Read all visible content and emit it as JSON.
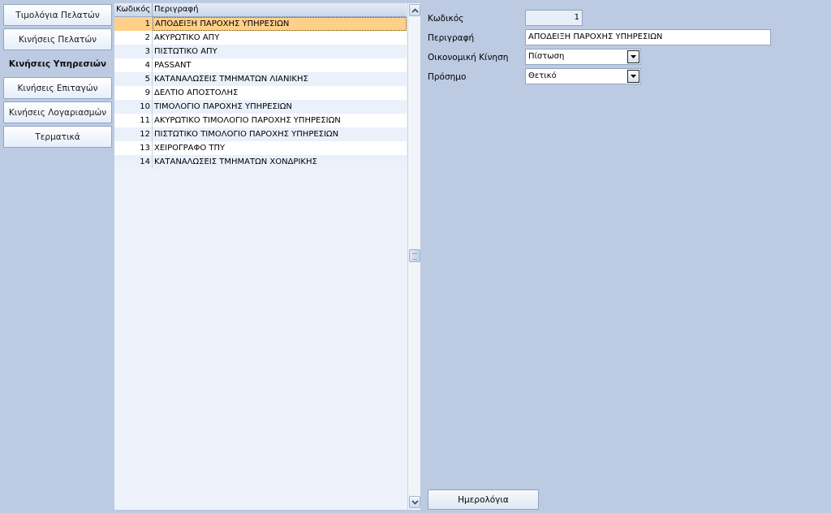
{
  "nav": {
    "items": [
      {
        "label": "Τιμολόγια Πελατών",
        "active": false
      },
      {
        "label": "Κινήσεις Πελατών",
        "active": false
      },
      {
        "label": "Κινήσεις Υπηρεσιών",
        "active": true
      },
      {
        "label": "Κινήσεις Επιταγών",
        "active": false
      },
      {
        "label": "Κινήσεις Λογαριασμών",
        "active": false
      },
      {
        "label": "Τερματικά",
        "active": false
      }
    ]
  },
  "grid": {
    "headers": {
      "code": "Κωδικός",
      "desc": "Περιγραφή"
    },
    "selected_index": 0,
    "rows": [
      {
        "code": "1",
        "desc": "ΑΠΟΔΕΙΞΗ ΠΑΡΟΧΗΣ ΥΠΗΡΕΣΙΩΝ"
      },
      {
        "code": "2",
        "desc": "ΑΚΥΡΩΤΙΚΟ ΑΠΥ"
      },
      {
        "code": "3",
        "desc": "ΠΙΣΤΩΤΙΚΟ ΑΠΥ"
      },
      {
        "code": "4",
        "desc": "PASSANT"
      },
      {
        "code": "5",
        "desc": "ΚΑΤΑΝΑΛΩΣΕΙΣ ΤΜΗΜΑΤΩΝ ΛΙΑΝΙΚΗΣ"
      },
      {
        "code": "9",
        "desc": "ΔΕΛΤΙΟ ΑΠΟΣΤΟΛΗΣ"
      },
      {
        "code": "10",
        "desc": "ΤΙΜΟΛΟΓΙΟ ΠΑΡΟΧΗΣ ΥΠΗΡΕΣΙΩΝ"
      },
      {
        "code": "11",
        "desc": "ΑΚΥΡΩΤΙΚΟ ΤΙΜΟΛΟΓΙΟ ΠΑΡΟΧΗΣ ΥΠΗΡΕΣΙΩΝ"
      },
      {
        "code": "12",
        "desc": "ΠΙΣΤΩΤΙΚΟ ΤΙΜΟΛΟΓΙΟ ΠΑΡΟΧΗΣ ΥΠΗΡΕΣΙΩΝ"
      },
      {
        "code": "13",
        "desc": "ΧΕΙΡΟΓΡΑΦΟ ΤΠΥ"
      },
      {
        "code": "14",
        "desc": "ΚΑΤΑΝΑΛΩΣΕΙΣ ΤΜΗΜΑΤΩΝ ΧΟΝΔΡΙΚΗΣ"
      }
    ]
  },
  "form": {
    "code_label": "Κωδικός",
    "code_value": "1",
    "desc_label": "Περιγραφή",
    "desc_value": "ΑΠΟΔΕΙΞΗ ΠΑΡΟΧΗΣ ΥΠΗΡΕΣΙΩΝ",
    "movement_label": "Οικονομική Κίνηση",
    "movement_value": "Πίστωση",
    "sign_label": "Πρόσημο",
    "sign_value": "Θετικό",
    "journals_button": "Ημερολόγια"
  },
  "colors": {
    "background": "#bccbe2",
    "selected_row": "#ffd08a",
    "alt_row": "#eaf1fb"
  }
}
